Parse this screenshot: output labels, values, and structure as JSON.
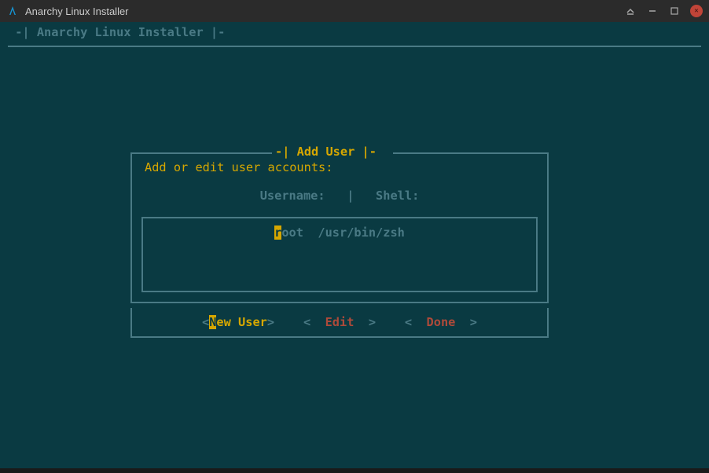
{
  "window": {
    "title": "Anarchy Linux Installer"
  },
  "header": {
    "text": " -| Anarchy Linux Installer |-"
  },
  "dialog": {
    "title": "-| Add User |-",
    "prompt": "Add or edit user accounts:",
    "columns": "Username:   |   Shell:",
    "users": [
      {
        "username_first": "r",
        "username_rest": "oot",
        "shell": "/usr/bin/zsh"
      }
    ],
    "buttons": {
      "new_user_first": "N",
      "new_user_rest": "ew User",
      "edit": "Edit",
      "done": "Done"
    }
  }
}
